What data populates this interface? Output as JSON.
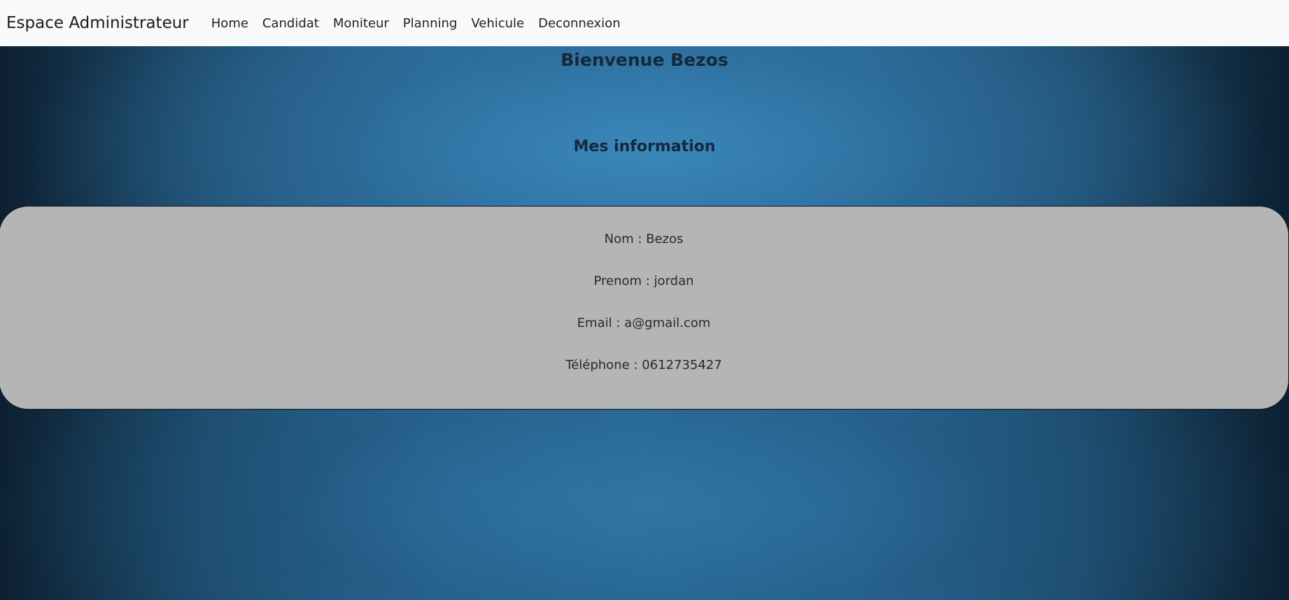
{
  "navbar": {
    "brand": "Espace Administrateur",
    "links": [
      "Home",
      "Candidat",
      "Moniteur",
      "Planning",
      "Vehicule",
      "Deconnexion"
    ]
  },
  "main": {
    "welcome": "Bienvenue Bezos",
    "section_title": "Mes information",
    "info": {
      "nom": "Nom : Bezos",
      "prenom": "Prenom : jordan",
      "email": "Email : a@gmail.com",
      "telephone": "Téléphone : 0612735427"
    }
  },
  "colors": {
    "navbar_bg": "#f8f9fa",
    "page_bg": "#2a6a98",
    "card_bg": "#b5b5b5",
    "heading_text": "#16283a"
  }
}
